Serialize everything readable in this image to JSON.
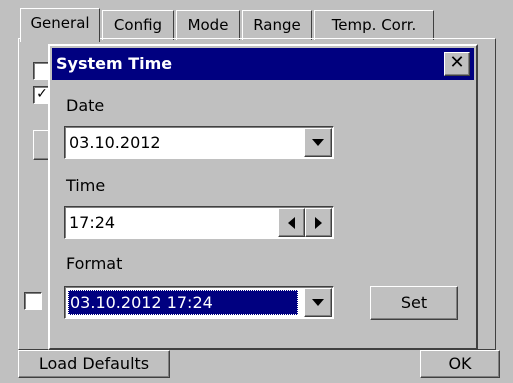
{
  "tabs": [
    {
      "label": "General"
    },
    {
      "label": "Config"
    },
    {
      "label": "Mode"
    },
    {
      "label": "Range"
    },
    {
      "label": "Temp. Corr."
    }
  ],
  "background": {
    "checkboxes": [
      {
        "checked": false,
        "mark": ""
      },
      {
        "checked": true,
        "mark": "✓"
      },
      {
        "checked": false,
        "mark": ""
      }
    ],
    "load_defaults_label": "Load Defaults",
    "ok_label": "OK"
  },
  "dialog": {
    "title": "System Time",
    "close_glyph": "✕",
    "date_label": "Date",
    "date_value": "03.10.2012",
    "time_label": "Time",
    "time_value": "17:24",
    "format_label": "Format",
    "format_value": "03.10.2012  17:24",
    "set_label": "Set"
  },
  "colors": {
    "titlebar": "#000080",
    "face": "#c0c0c0",
    "selection": "#000080"
  }
}
